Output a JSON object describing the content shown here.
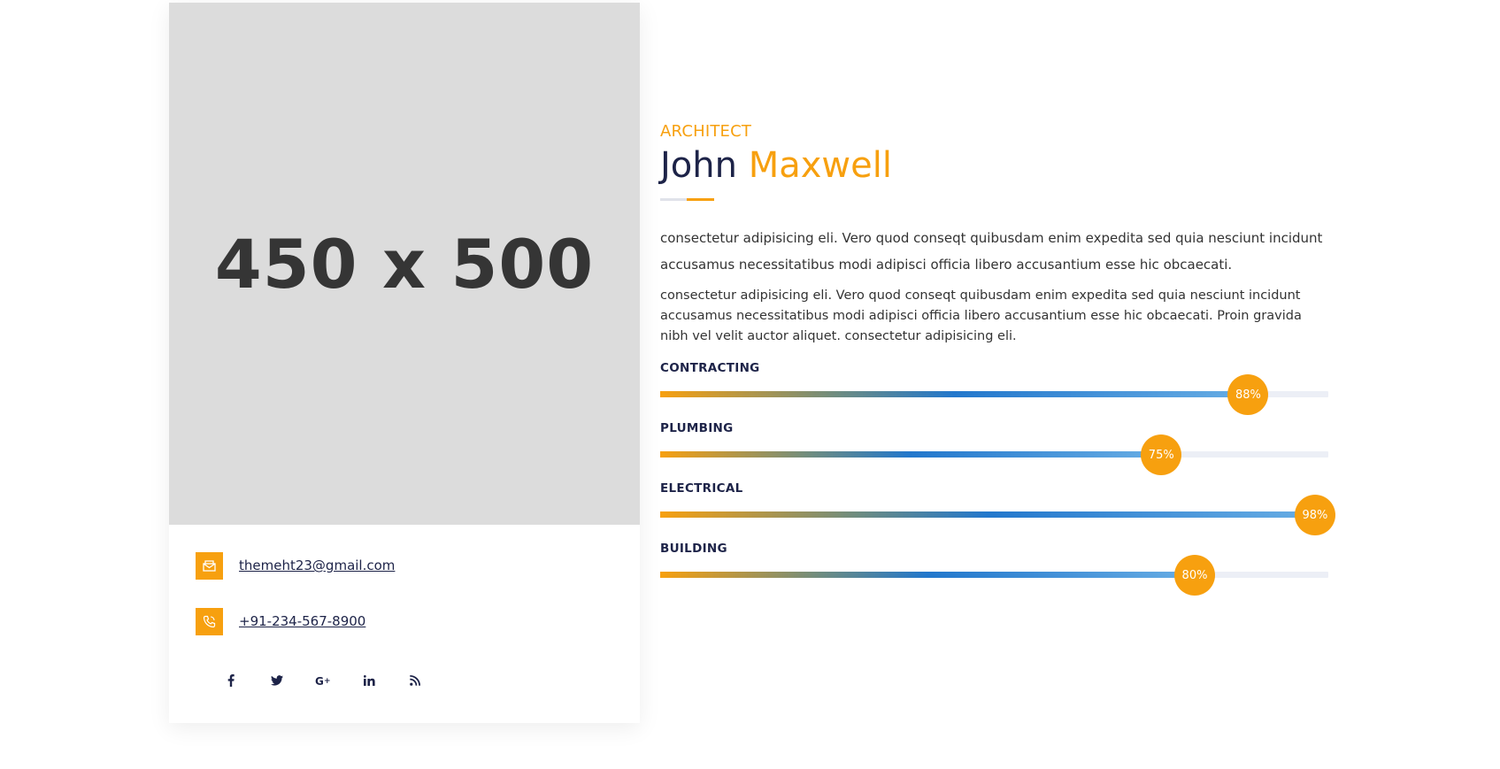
{
  "image": {
    "placeholder_text": "450 x 500"
  },
  "contact": {
    "email": "themeht23@gmail.com",
    "phone": "+91-234-567-8900"
  },
  "social": [
    {
      "icon": "facebook-icon",
      "glyph": "f"
    },
    {
      "icon": "twitter-icon",
      "glyph": "t"
    },
    {
      "icon": "google-plus-icon",
      "glyph": "G+"
    },
    {
      "icon": "linkedin-icon",
      "glyph": "in"
    },
    {
      "icon": "rss-icon",
      "glyph": "rss"
    }
  ],
  "profile": {
    "role": "ARCHITECT",
    "first_name": "John",
    "last_name": "Maxwell",
    "paragraph_1": "consectetur adipisicing eli. Vero quod conseqt quibusdam enim expedita sed quia nesciunt incidunt accusamus necessitatibus modi adipisci officia libero accusantium esse hic obcaecati.",
    "paragraph_2": "consectetur adipisicing eli. Vero quod conseqt quibusdam enim expedita sed quia nesciunt incidunt accusamus necessitatibus modi adipisci officia libero accusantium esse hic obcaecati. Proin gravida nibh vel velit auctor aliquet. consectetur adipisicing eli."
  },
  "skills": [
    {
      "label": "CONTRACTING",
      "percent": 88,
      "percent_text": "88%"
    },
    {
      "label": "PLUMBING",
      "percent": 75,
      "percent_text": "75%"
    },
    {
      "label": "ELECTRICAL",
      "percent": 98,
      "percent_text": "98%"
    },
    {
      "label": "BUILDING",
      "percent": 80,
      "percent_text": "80%"
    }
  ],
  "colors": {
    "accent": "#f7a00f",
    "heading": "#1d2348",
    "placeholder_bg": "#dcdcdc",
    "track": "#eceff6"
  }
}
